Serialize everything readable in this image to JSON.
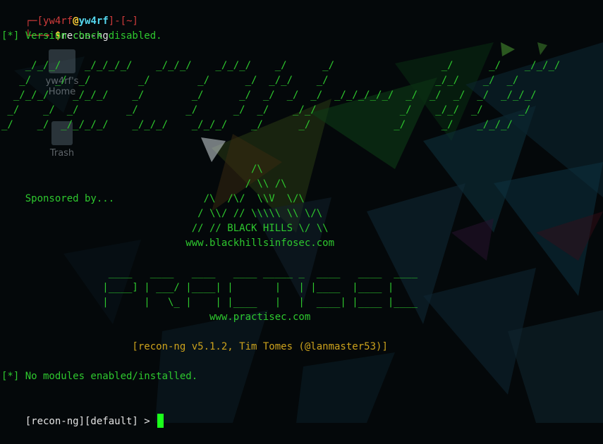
{
  "desktop": {
    "icons": [
      {
        "label": "yw4rf's Home",
        "icon": "folder-icon"
      },
      {
        "label": "Trash",
        "icon": "trash-icon"
      }
    ]
  },
  "prompt": {
    "open_bracket": "[",
    "user": "yw4rf",
    "at": "@",
    "host": "yw4rf",
    "close_bracket": "]",
    "dash": "-",
    "dir_open": "[",
    "dir": "~",
    "dir_close": "]",
    "symbol": "$",
    "command": "recon-ng"
  },
  "output": {
    "version_check": "[*] Version check disabled.",
    "banner": [
      "    _/_/_/    _/_/_/_/    _/_/_/    _/_/_/    _/      _/                  _/      _/    _/_/_/",
      "   _/    _/  _/        _/        _/      _/  _/_/    _/                  _/_/    _/  _/",
      "  _/_/_/    _/_/_/    _/        _/      _/  _/  _/  _/  _/_/_/_/_/  _/  _/  _/  _/  _/_/_/",
      " _/    _/  _/        _/        _/      _/  _/    _/_/              _/    _/_/  _/      _/",
      "_/    _/  _/_/_/_/    _/_/_/    _/_/_/    _/      _/              _/      _/    _/_/_/"
    ],
    "bhis_art": [
      "                                          /\\",
      "                                         / \\\\ /\\",
      "    Sponsored by...               /\\  /\\/  \\\\V  \\/\\",
      "                                 / \\\\/ // \\\\\\\\\\ \\\\ \\/\\",
      "                                // // BLACK HILLS \\/ \\\\",
      "                               www.blackhillsinfosec.com"
    ],
    "practisec_art": [
      "                  ____   ____   ____   ____ _____ _  ____   ____  ____",
      "                 |____] | ___/ |____| |       |   | |____  |____ |",
      "                 |      |   \\_ |    | |____   |   |  ____| |____ |____",
      "                                   www.practisec.com"
    ],
    "version_info": "                      [recon-ng v5.1.2, Tim Tomes (@lanmaster53)]",
    "modules_status": "[*] No modules enabled/installed.",
    "shell_prompt": "[recon-ng][default] > "
  },
  "colors": {
    "terminal_green": "#2ec82e",
    "version_yellow": "#cca21c",
    "prompt_red": "#d13b3b",
    "prompt_cyan": "#55d7ee",
    "cursor_green": "#1bff1b"
  }
}
